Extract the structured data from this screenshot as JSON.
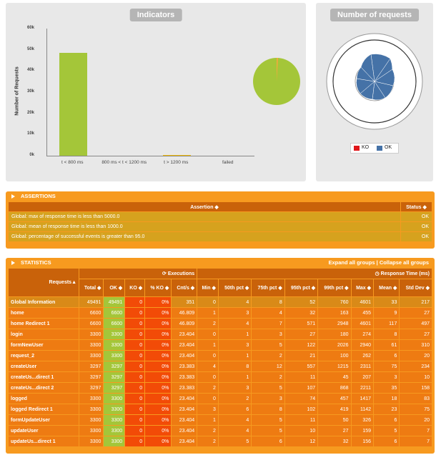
{
  "indicators": {
    "title": "Indicators",
    "chart_data": {
      "type": "bar",
      "ylabel": "Number of Requests",
      "yticks": [
        "60k",
        "50k",
        "40k",
        "30k",
        "20k",
        "10k",
        "0k"
      ],
      "categories": [
        "t < 800 ms",
        "800 ms < t < 1200 ms",
        "t > 1200 ms",
        "failed"
      ],
      "values": [
        48700,
        0,
        200,
        0
      ],
      "ylim": [
        0,
        60000
      ],
      "colors": [
        "#a4c639",
        "#a4c639",
        "#f0b800",
        "#ff0000"
      ]
    },
    "pie": {
      "ok_fraction": 0.99,
      "ok_color": "#a4c639",
      "ko_color": "#f4a93c"
    }
  },
  "number_of_requests": {
    "title": "Number of requests",
    "legend": [
      {
        "label": "KO",
        "color": "#e0171b"
      },
      {
        "label": "OK",
        "color": "#4572a7"
      }
    ]
  },
  "assertions": {
    "section_title": "ASSERTIONS",
    "col_assertion": "Assertion",
    "col_status": "Status",
    "rows": [
      {
        "text": "Global: max of response time is less than 5000.0",
        "status": "OK"
      },
      {
        "text": "Global: mean of response time is less than 1000.0",
        "status": "OK"
      },
      {
        "text": "Global: percentage of successful events is greater than 95.0",
        "status": "OK"
      }
    ]
  },
  "statistics": {
    "section_title": "STATISTICS",
    "expand_link": "Expand all groups",
    "sep": "|",
    "collapse_link": "Collapse all groups",
    "hdr_requests": "Requests",
    "hdr_executions": "Executions",
    "hdr_response_time": "Response Time (ms)",
    "cols": [
      "Total",
      "OK",
      "KO",
      "% KO",
      "Cnt/s",
      "Min",
      "50th pct",
      "75th pct",
      "95th pct",
      "99th pct",
      "Max",
      "Mean",
      "Std Dev"
    ],
    "rows": [
      [
        "Global Information",
        "49491",
        "49491",
        "0",
        "0%",
        "351",
        "0",
        "4",
        "8",
        "52",
        "760",
        "4601",
        "33",
        "217"
      ],
      [
        "home",
        "6600",
        "6600",
        "0",
        "0%",
        "46.809",
        "1",
        "3",
        "4",
        "32",
        "163",
        "455",
        "9",
        "27"
      ],
      [
        "home Redirect 1",
        "6600",
        "6600",
        "0",
        "0%",
        "46.809",
        "2",
        "4",
        "7",
        "571",
        "2948",
        "4601",
        "117",
        "497"
      ],
      [
        "login",
        "3300",
        "3300",
        "0",
        "0%",
        "23.404",
        "0",
        "1",
        "3",
        "27",
        "180",
        "274",
        "8",
        "27"
      ],
      [
        "formNewUser",
        "3300",
        "3300",
        "0",
        "0%",
        "23.404",
        "1",
        "3",
        "5",
        "122",
        "2026",
        "2940",
        "61",
        "310"
      ],
      [
        "request_2",
        "3300",
        "3300",
        "0",
        "0%",
        "23.404",
        "0",
        "1",
        "2",
        "21",
        "100",
        "262",
        "6",
        "20"
      ],
      [
        "createUser",
        "3297",
        "3297",
        "0",
        "0%",
        "23.383",
        "4",
        "8",
        "12",
        "557",
        "1215",
        "2311",
        "75",
        "234"
      ],
      [
        "createUs...direct 1",
        "3297",
        "3297",
        "0",
        "0%",
        "23.383",
        "0",
        "1",
        "2",
        "11",
        "45",
        "207",
        "3",
        "10"
      ],
      [
        "createUs...direct 2",
        "3297",
        "3297",
        "0",
        "0%",
        "23.383",
        "2",
        "3",
        "5",
        "107",
        "868",
        "2211",
        "35",
        "158"
      ],
      [
        "logged",
        "3300",
        "3300",
        "0",
        "0%",
        "23.404",
        "0",
        "2",
        "3",
        "74",
        "457",
        "1417",
        "18",
        "83"
      ],
      [
        "logged Redirect 1",
        "3300",
        "3300",
        "0",
        "0%",
        "23.404",
        "3",
        "6",
        "8",
        "102",
        "419",
        "1142",
        "23",
        "75"
      ],
      [
        "formUpdateUser",
        "3300",
        "3300",
        "0",
        "0%",
        "23.404",
        "1",
        "4",
        "5",
        "11",
        "50",
        "326",
        "6",
        "20"
      ],
      [
        "updateUser",
        "3300",
        "3300",
        "0",
        "0%",
        "23.404",
        "2",
        "4",
        "5",
        "10",
        "27",
        "159",
        "5",
        "7"
      ],
      [
        "updateUs...direct 1",
        "3300",
        "3300",
        "0",
        "0%",
        "23.404",
        "2",
        "5",
        "6",
        "12",
        "32",
        "156",
        "6",
        "7"
      ]
    ]
  }
}
